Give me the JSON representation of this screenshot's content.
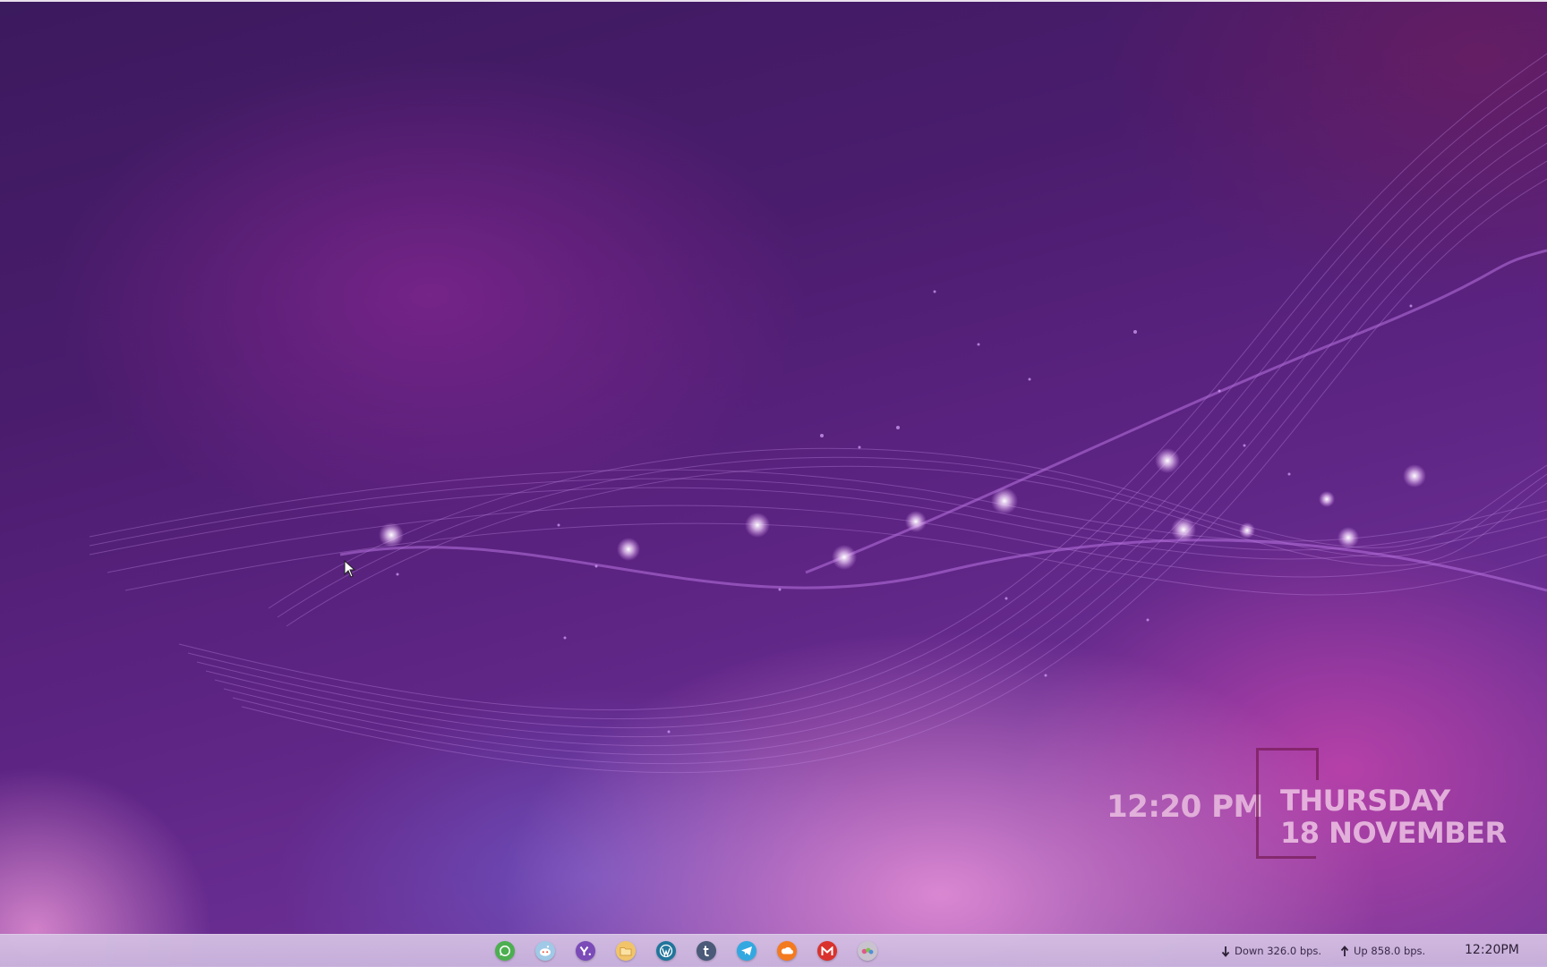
{
  "desktop": {
    "widget": {
      "time": "12:20 PM",
      "day": "THURSDAY",
      "date": "18 NOVEMBER"
    }
  },
  "taskbar": {
    "apps": [
      {
        "name": "whatsapp-icon",
        "color": "#4caf50"
      },
      {
        "name": "reddit-icon",
        "color": "#9fc9e6"
      },
      {
        "name": "yahoo-icon",
        "color": "#7b4bb8"
      },
      {
        "name": "folder-icon",
        "color": "#f1c46a"
      },
      {
        "name": "wordpress-icon",
        "color": "#21759b"
      },
      {
        "name": "tumblr-icon",
        "color": "#4a5a78"
      },
      {
        "name": "telegram-icon",
        "color": "#33a8e0"
      },
      {
        "name": "soundcloud-icon",
        "color": "#f47a1f"
      },
      {
        "name": "gmail-icon",
        "color": "#d9322d"
      },
      {
        "name": "app-icon",
        "color": "#c9c3cf"
      }
    ],
    "network": {
      "down": "Down 326.0 bps.",
      "up": "Up 858.0 bps."
    },
    "clock": "12:20PM"
  }
}
